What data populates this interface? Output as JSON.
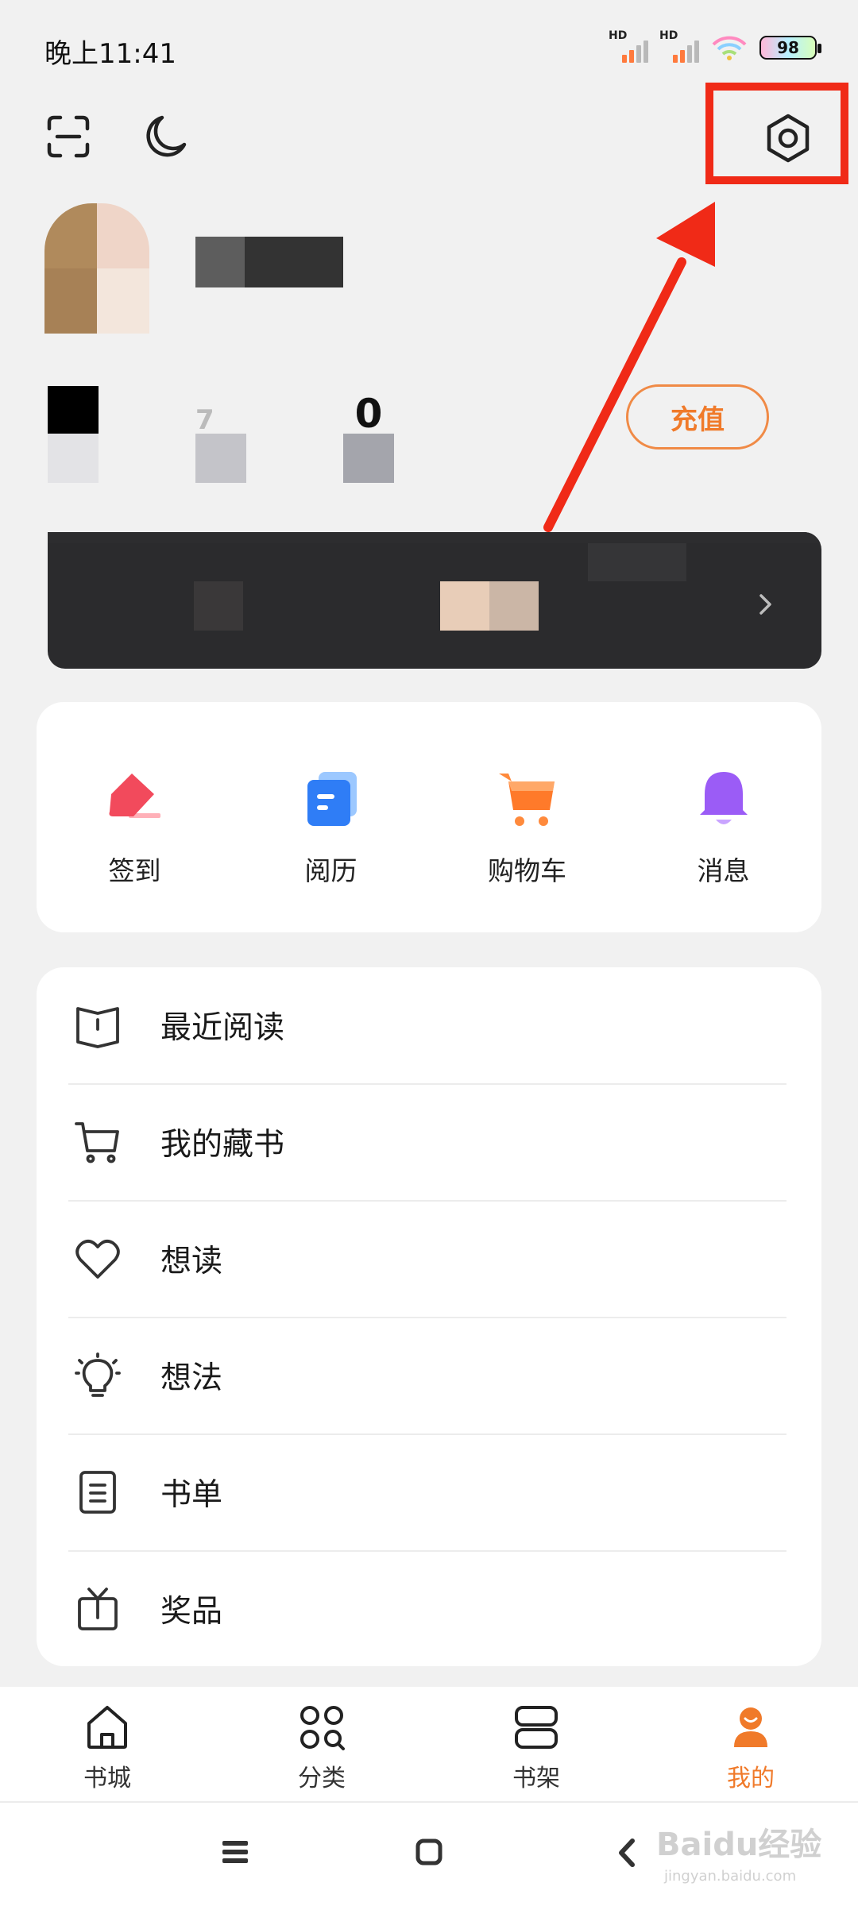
{
  "status_bar": {
    "time": "晚上11:41",
    "sim1_label": "HD",
    "sim2_label": "HD",
    "battery_level": "98"
  },
  "header": {
    "icons": [
      "scan-icon",
      "moon-icon",
      "settings-icon"
    ],
    "username_redacted": true
  },
  "stats": [
    {
      "value": "",
      "label_redacted": true
    },
    {
      "value": "7",
      "label_redacted": true
    },
    {
      "value": "0",
      "label_redacted": true
    }
  ],
  "recharge_label": "充值",
  "banner": {
    "redacted": true,
    "chevron": "chevron-right-icon"
  },
  "quick_actions": [
    {
      "label": "签到",
      "icon": "checkin-icon"
    },
    {
      "label": "阅历",
      "icon": "reading-history-icon"
    },
    {
      "label": "购物车",
      "icon": "cart-icon"
    },
    {
      "label": "消息",
      "icon": "bell-icon"
    }
  ],
  "menu": [
    {
      "label": "最近阅读",
      "icon": "book-open-icon"
    },
    {
      "label": "我的藏书",
      "icon": "cart-outline-icon"
    },
    {
      "label": "想读",
      "icon": "heart-icon"
    },
    {
      "label": "想法",
      "icon": "bulb-icon"
    },
    {
      "label": "书单",
      "icon": "list-doc-icon"
    },
    {
      "label": "奖品",
      "icon": "gift-icon"
    }
  ],
  "tabs": [
    {
      "label": "书城",
      "icon": "home-icon",
      "active": false
    },
    {
      "label": "分类",
      "icon": "category-icon",
      "active": false
    },
    {
      "label": "书架",
      "icon": "bookshelf-icon",
      "active": false
    },
    {
      "label": "我的",
      "icon": "profile-icon",
      "active": true
    }
  ],
  "colors": {
    "accent": "#f07a2a",
    "annotation": "#f02a17",
    "background": "#f1f1f1"
  },
  "watermark": {
    "main": "Baidu经验",
    "sub": "jingyan.baidu.com"
  }
}
